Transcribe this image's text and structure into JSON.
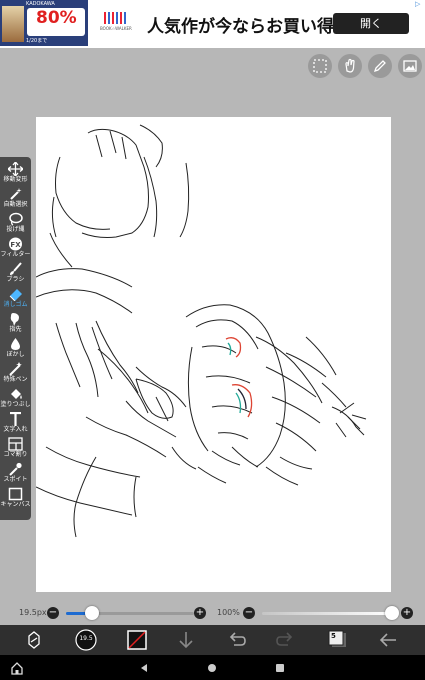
{
  "ad": {
    "thumb_top_text": "KADOKAWA",
    "thumb_pct": "80%",
    "thumb_bottom_text": "1/20まで",
    "logo_text": "BOOK☆WALKER",
    "title": "人気作が今ならお買い得",
    "open_label": "開く"
  },
  "toolbar": {
    "items": [
      {
        "label": "移動変形",
        "icon": "move-icon"
      },
      {
        "label": "自動選択",
        "icon": "magic-wand-icon"
      },
      {
        "label": "投げ縄",
        "icon": "lasso-icon"
      },
      {
        "label": "フィルター",
        "icon": "fx-icon"
      },
      {
        "label": "ブラシ",
        "icon": "brush-icon"
      },
      {
        "label": "消しゴム",
        "icon": "eraser-icon"
      },
      {
        "label": "指先",
        "icon": "finger-icon"
      },
      {
        "label": "ぼかし",
        "icon": "blur-icon"
      },
      {
        "label": "特殊ペン",
        "icon": "special-pen-icon"
      },
      {
        "label": "塗りつぶし",
        "icon": "fill-icon"
      },
      {
        "label": "文字入れ",
        "icon": "text-icon"
      },
      {
        "label": "コマ割り",
        "icon": "frame-divider-icon"
      },
      {
        "label": "スポイト",
        "icon": "eyedropper-icon"
      },
      {
        "label": "キャンバス",
        "icon": "canvas-icon"
      }
    ],
    "active_index": 5,
    "active_color": "#4db7ff"
  },
  "brush": {
    "size_label": "19.5px",
    "size_fraction": 0.2,
    "opacity_label": "100%",
    "opacity_fraction": 1.0,
    "preview_text": "19.5"
  },
  "appbar": {
    "layer_number": "5",
    "accent_blue": "#1d6bd1"
  }
}
